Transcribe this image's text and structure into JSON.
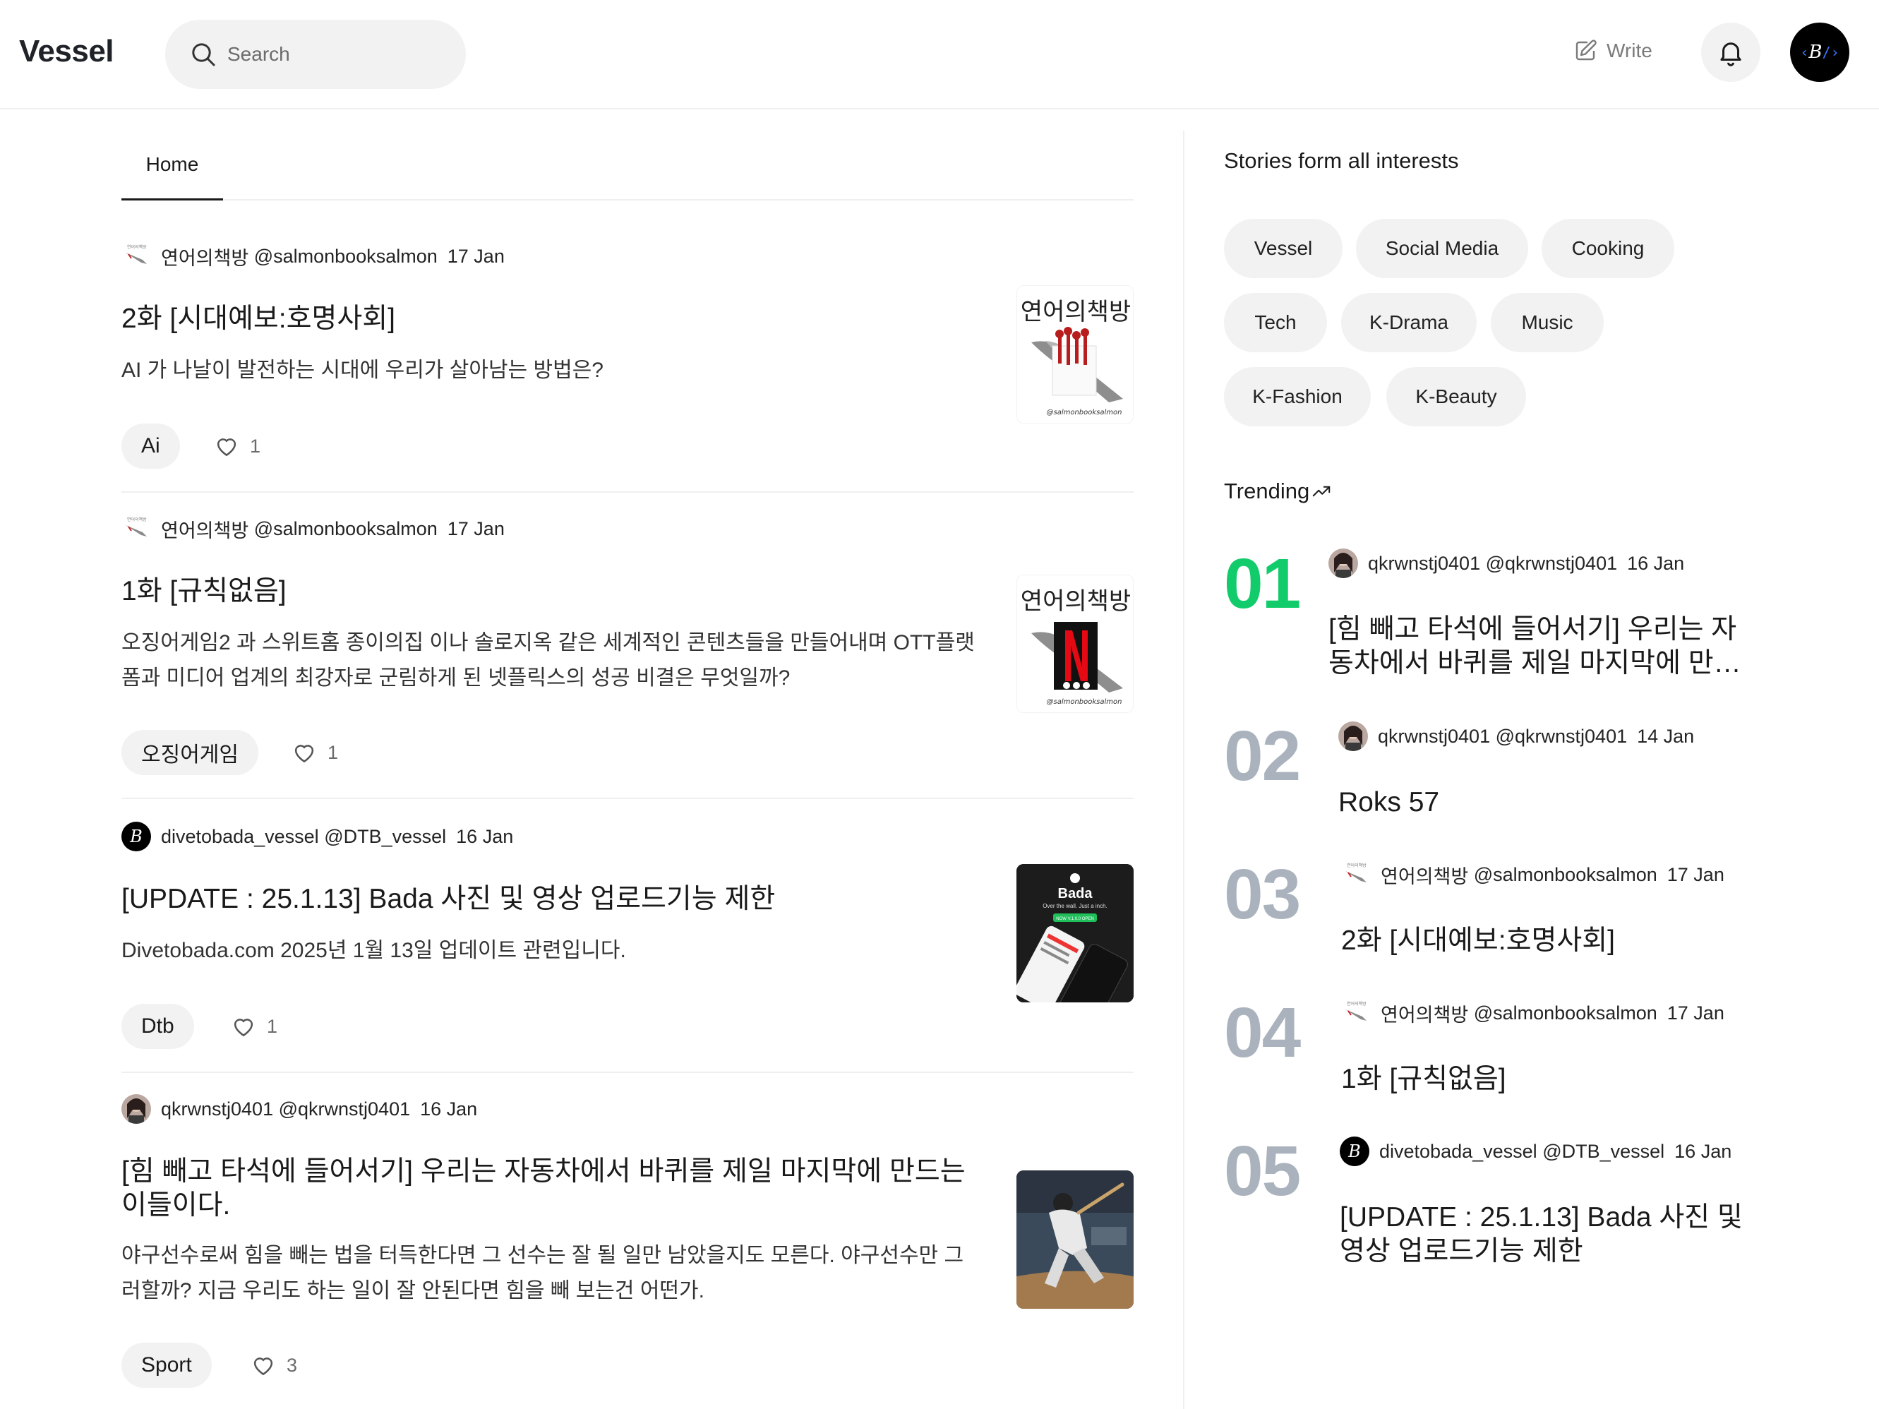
{
  "header": {
    "logo": "Vessel",
    "search_placeholder": "Search",
    "write_label": "Write"
  },
  "feed": {
    "tabs": [
      {
        "label": "Home"
      }
    ],
    "posts": [
      {
        "author": "연어의책방",
        "handle": "@salmonbooksalmon",
        "date": "17 Jan",
        "title": "2화 [시대예보:호명사회]",
        "description": "AI 가 나날이 발전하는 시대에 우리가 살아남는 방법은?",
        "tag": "Ai",
        "likes": "1"
      },
      {
        "author": "연어의책방",
        "handle": "@salmonbooksalmon",
        "date": "17 Jan",
        "title": "1화 [규칙없음]",
        "description": "오징어게임2 과 스위트홈 종이의집 이나 솔로지옥 같은 세계적인 콘텐츠들을 만들어내며 OTT플랫폼과 미디어 업계의 최강자로 군림하게 된 넷플릭스의 성공 비결은 무엇일까?",
        "tag": "오징어게임",
        "likes": "1"
      },
      {
        "author": "divetobada_vessel",
        "handle": "@DTB_vessel",
        "date": "16 Jan",
        "title": "[UPDATE : 25.1.13] Bada 사진 및 영상 업로드기능 제한",
        "description": "Divetobada.com 2025년 1월 13일 업데이트 관련입니다.",
        "tag": "Dtb",
        "likes": "1"
      },
      {
        "author": "qkrwnstj0401",
        "handle": "@qkrwnstj0401",
        "date": "16 Jan",
        "title": "[힘 빼고 타석에 들어서기] 우리는 자동차에서 바퀴를 제일 마지막에 만드는 이들이다.",
        "description": "야구선수로써 힘을 빼는 법을 터득한다면 그 선수는 잘 될 일만 남았을지도 모른다. 야구선수만 그러할까? 지금 우리도 하는 일이 잘 안된다면 힘을 빼 보는건 어떤가.",
        "tag": "Sport",
        "likes": "3"
      }
    ],
    "thumbs": {
      "salmon_text": "연어의책방",
      "salmon_small": "@salmonbooksalmon",
      "bada_title": "Bada",
      "bada_sub": "Over the wall. Just a inch.",
      "bada_btn": "NOW V.1.0.0 OPEN"
    }
  },
  "sidebar": {
    "stories_title": "Stories form all interests",
    "chips": [
      "Vessel",
      "Social Media",
      "Cooking",
      "Tech",
      "K-Drama",
      "Music",
      "K-Fashion",
      "K-Beauty"
    ],
    "trending_title": "Trending",
    "trending": [
      {
        "rank": "01",
        "author": "qkrwnstj0401",
        "handle": "@qkrwnstj0401",
        "date": "16 Jan",
        "title": "[힘 빼고 타석에 들어서기] 우리는 자동차에서 바퀴를 제일 마지막에 만드는 이들이다."
      },
      {
        "rank": "02",
        "author": "qkrwnstj0401",
        "handle": "@qkrwnstj0401",
        "date": "14 Jan",
        "title": "Roks 57"
      },
      {
        "rank": "03",
        "author": "연어의책방",
        "handle": "@salmonbooksalmon",
        "date": "17 Jan",
        "title": "2화 [시대예보:호명사회]"
      },
      {
        "rank": "04",
        "author": "연어의책방",
        "handle": "@salmonbooksalmon",
        "date": "17 Jan",
        "title": "1화 [규칙없음]"
      },
      {
        "rank": "05",
        "author": "divetobada_vessel",
        "handle": "@DTB_vessel",
        "date": "16 Jan",
        "title": "[UPDATE : 25.1.13] Bada 사진 및 영상 업로드기능 제한"
      }
    ]
  },
  "colors": {
    "accent_green": "#12cc6b",
    "rank_gray": "#aab3bd",
    "chip_bg": "#f2f2f2",
    "divider": "#efefef"
  },
  "icons": {
    "search": "search-icon",
    "write": "write-icon",
    "bell": "bell-icon",
    "heart": "heart-icon",
    "trend": "trending-arrow-icon"
  }
}
